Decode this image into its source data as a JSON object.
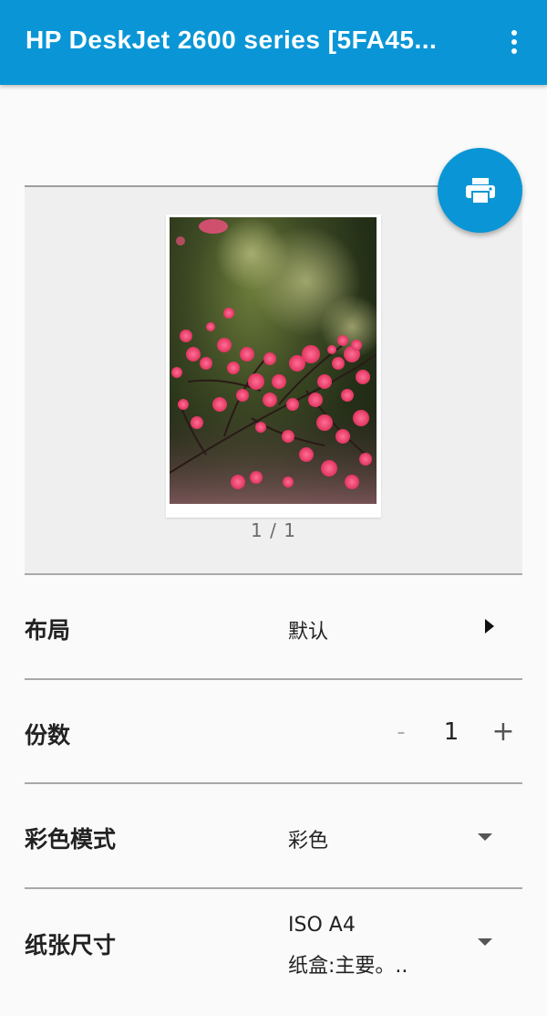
{
  "appbar": {
    "title": "HP DeskJet 2600 series [5FA45...",
    "more_icon": "more-vert-icon",
    "color": "#0a96d6"
  },
  "fab": {
    "icon": "printer-icon"
  },
  "preview": {
    "page_counter": "1 / 1"
  },
  "settings": {
    "layout": {
      "label": "布局",
      "value": "默认"
    },
    "copies": {
      "label": "份数",
      "minus": "-",
      "value": "1",
      "plus": "+"
    },
    "color_mode": {
      "label": "彩色模式",
      "value": "彩色"
    },
    "paper_size": {
      "label": "纸张尺寸",
      "value_line1": "ISO A4",
      "value_line2": "纸盒:主要。.."
    }
  }
}
